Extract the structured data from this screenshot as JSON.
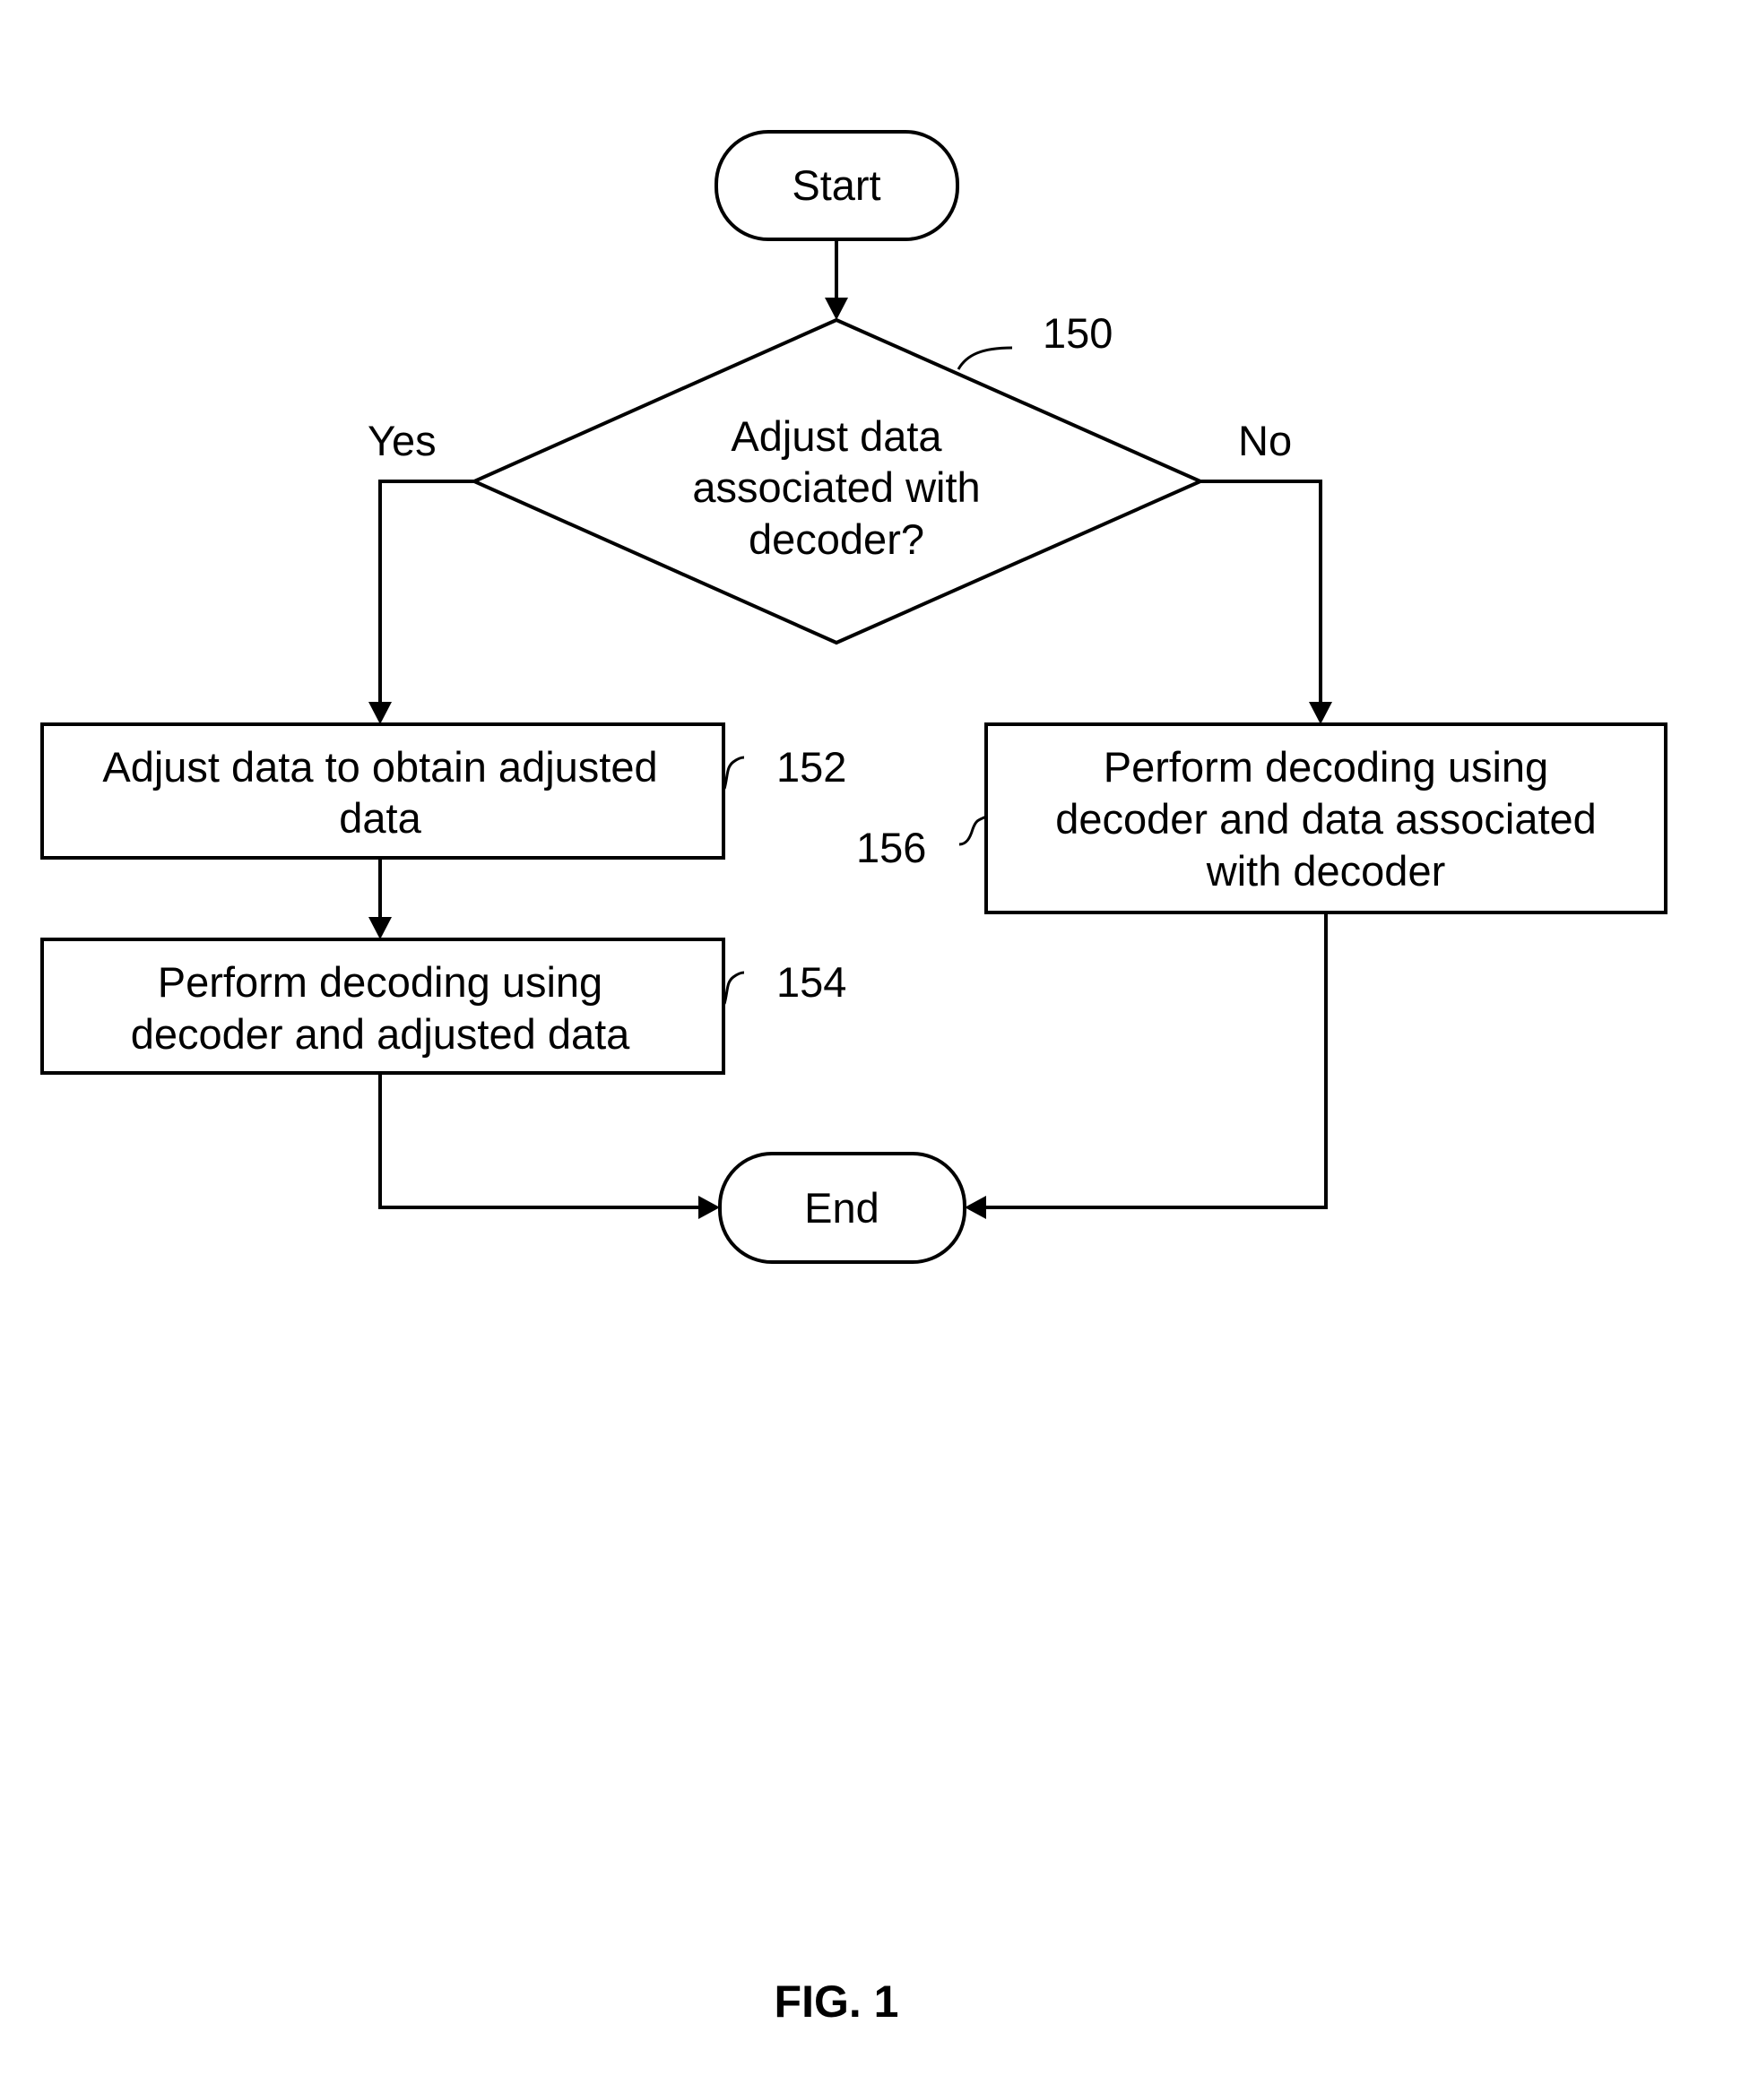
{
  "figure": {
    "caption": "FIG. 1"
  },
  "nodes": {
    "start": {
      "label": "Start"
    },
    "decision": {
      "ref": "150",
      "lines": [
        "Adjust data",
        "associated with",
        "decoder?"
      ]
    },
    "adjust": {
      "ref": "152",
      "lines": [
        "Adjust data to obtain adjusted",
        "data"
      ]
    },
    "decode_adjusted": {
      "ref": "154",
      "lines": [
        "Perform decoding using",
        "decoder and adjusted data"
      ]
    },
    "decode_original": {
      "ref": "156",
      "lines": [
        "Perform decoding using",
        "decoder and data associated",
        "with decoder"
      ]
    },
    "end": {
      "label": "End"
    }
  },
  "edges": {
    "yes_label": "Yes",
    "no_label": "No"
  }
}
